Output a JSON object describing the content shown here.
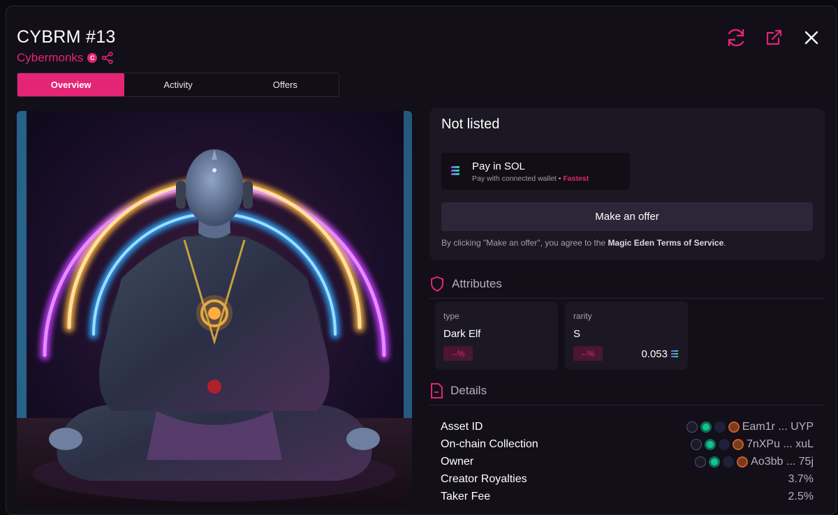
{
  "header": {
    "title": "CYBRM #13",
    "collection": "Cybermonks",
    "verified_badge": "C"
  },
  "top_icons": [
    "refresh-icon",
    "external-link-icon",
    "close-icon"
  ],
  "tabs": [
    {
      "label": "Overview",
      "active": true
    },
    {
      "label": "Activity",
      "active": false
    },
    {
      "label": "Offers",
      "active": false
    }
  ],
  "status": {
    "headline": "Not listed",
    "pay": {
      "title": "Pay in SOL",
      "subtitle": "Pay with connected wallet",
      "separator": "•",
      "speed": "Fastest"
    },
    "offer_button": "Make an offer",
    "terms_prefix": "By clicking \"Make an offer\", you agree to the ",
    "terms_link": "Magic Eden Terms of Service",
    "terms_suffix": "."
  },
  "attributes": {
    "heading": "Attributes",
    "items": [
      {
        "key": "type",
        "value": "Dark Elf",
        "percent": "--%",
        "price": ""
      },
      {
        "key": "rarity",
        "value": "S",
        "percent": "--%",
        "price": "0.053"
      }
    ]
  },
  "details": {
    "heading": "Details",
    "rows": [
      {
        "label": "Asset ID",
        "value": "Eam1r ... UYP"
      },
      {
        "label": "On-chain Collection",
        "value": "7nXPu ... xuL"
      },
      {
        "label": "Owner",
        "value": "Ao3bb ... 75j"
      },
      {
        "label": "Creator Royalties",
        "value": "3.7%"
      },
      {
        "label": "Taker Fee",
        "value": "2.5%"
      }
    ]
  },
  "colors": {
    "accent": "#e42575",
    "panel": "#1b1823",
    "background": "#120f18"
  }
}
